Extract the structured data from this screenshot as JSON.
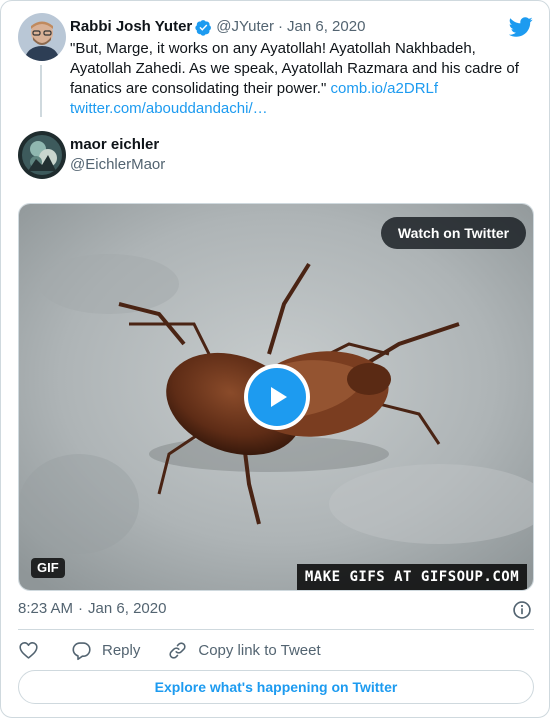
{
  "quoted_tweet": {
    "name": "Rabbi Josh Yuter",
    "handle": "@JYuter",
    "separator": "·",
    "date": "Jan 6, 2020",
    "text": "\"But, Marge, it works on any Ayatollah! Ayatollah Nakhbadeh, Ayatollah Zahedi. As we speak, Ayatollah Razmara and his cadre of fanatics are consolidating their power.\"",
    "link_1": "comb.io/a2DRLf",
    "link_2": "twitter.com/abouddandachi/…",
    "verified_icon": "verified-badge-icon"
  },
  "tweet": {
    "name": "maor eichler",
    "handle": "@EichlerMaor",
    "media": {
      "watch_label": "Watch on Twitter",
      "gif_badge": "GIF",
      "watermark": "MAKE GIFS AT GIFSOUP.COM",
      "play_icon": "play-icon"
    },
    "time": "8:23 AM",
    "separator": "·",
    "date": "Jan 6, 2020"
  },
  "actions": {
    "like_icon": "heart-icon",
    "reply_label": "Reply",
    "copy_label": "Copy link to Tweet"
  },
  "explore_label": "Explore what's happening on Twitter",
  "colors": {
    "accent": "#1d9bf0",
    "text": "#0f1419",
    "secondary": "#536471",
    "border": "#cfd9de"
  }
}
